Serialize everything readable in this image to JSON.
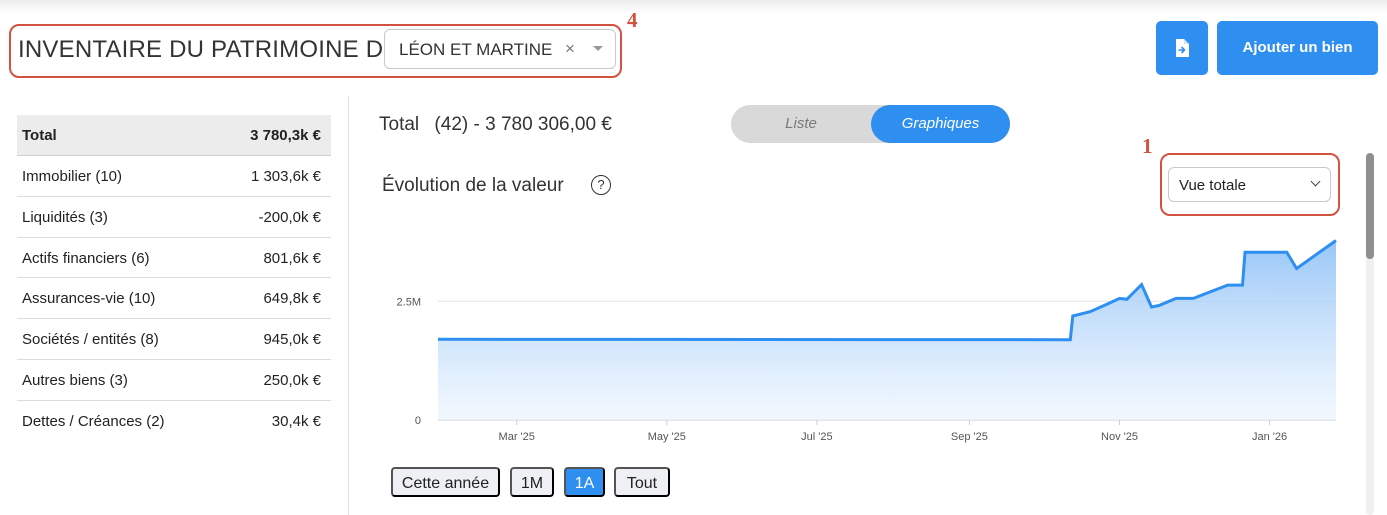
{
  "header": {
    "title": "INVENTAIRE DU PATRIMOINE DE",
    "owner": "LÉON ET MARTINE",
    "clear": "×",
    "annotation": "4",
    "add_label": "Ajouter un bien",
    "accent": "#2f8ff0",
    "annotation_color": "#d3523f"
  },
  "summary": {
    "total_label": "Total",
    "total_value": "3 780,3k €",
    "rows": [
      {
        "label": "Immobilier (10)",
        "value": "1 303,6k €"
      },
      {
        "label": "Liquidités (3)",
        "value": "-200,0k €"
      },
      {
        "label": "Actifs financiers (6)",
        "value": "801,6k €"
      },
      {
        "label": "Assurances-vie (10)",
        "value": "649,8k €"
      },
      {
        "label": "Sociétés / entités (8)",
        "value": "945,0k €"
      },
      {
        "label": "Autres biens (3)",
        "value": "250,0k €"
      },
      {
        "label": "Dettes / Créances (2)",
        "value": "30,4k €"
      }
    ]
  },
  "main": {
    "total_label": "Total",
    "total_detail": "(42) - 3 780 306,00 €",
    "toggle": {
      "liste": "Liste",
      "graphiques": "Graphiques",
      "active": "graphiques"
    },
    "section_title": "Évolution de la valeur",
    "help": "?",
    "view_select": "Vue totale",
    "annotation": "1",
    "range_buttons": [
      {
        "label": "Cette année",
        "active": false
      },
      {
        "label": "1M",
        "active": false
      },
      {
        "label": "1A",
        "active": true
      },
      {
        "label": "Tout",
        "active": false
      }
    ]
  },
  "chart_data": {
    "type": "area",
    "x_ticks": [
      "Mar '25",
      "May '25",
      "Jul '25",
      "Sep '25",
      "Nov '25",
      "Jan '26"
    ],
    "y_ticks": [
      "0",
      "2.5M"
    ],
    "ylim": [
      0,
      4000000
    ],
    "grid": true,
    "series": [
      {
        "x": [
          "2025-01-28",
          "2025-10-12",
          "2025-10-13",
          "2025-10-20",
          "2025-10-27",
          "2025-11-01",
          "2025-11-04",
          "2025-11-08",
          "2025-11-10",
          "2025-11-14",
          "2025-11-17",
          "2025-11-24",
          "2025-12-01",
          "2025-12-15",
          "2025-12-21",
          "2025-12-22",
          "2026-01-08",
          "2026-01-12",
          "2026-01-28"
        ],
        "values": [
          1700000,
          1690000,
          2190000,
          2280000,
          2440000,
          2560000,
          2540000,
          2750000,
          2850000,
          2380000,
          2410000,
          2560000,
          2560000,
          2840000,
          2840000,
          3530000,
          3530000,
          3190000,
          3780000
        ]
      }
    ]
  }
}
